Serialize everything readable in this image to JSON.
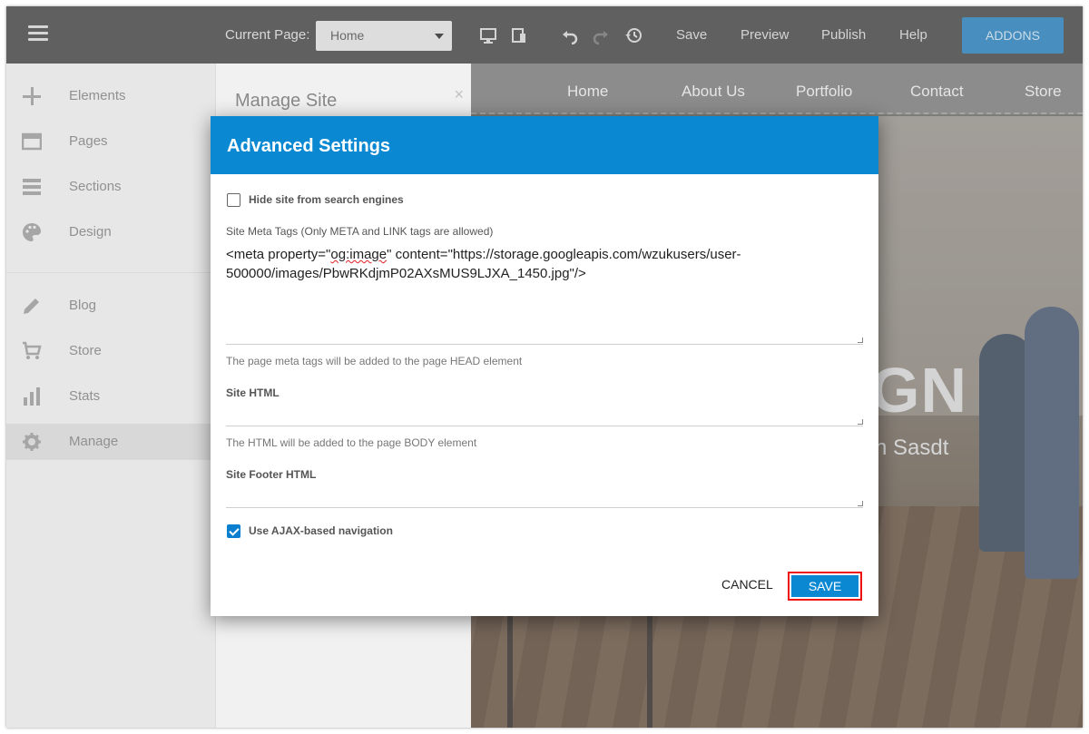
{
  "topbar": {
    "current_page_label": "Current Page:",
    "current_page_value": "Home",
    "save": "Save",
    "preview": "Preview",
    "publish": "Publish",
    "help": "Help",
    "addons": "ADDONS"
  },
  "sidebar": {
    "items": [
      {
        "label": "Elements",
        "icon": "plus-icon"
      },
      {
        "label": "Pages",
        "icon": "pages-icon"
      },
      {
        "label": "Sections",
        "icon": "sections-icon"
      },
      {
        "label": "Design",
        "icon": "palette-icon"
      },
      {
        "label": "Blog",
        "icon": "pencil-icon"
      },
      {
        "label": "Store",
        "icon": "cart-icon"
      },
      {
        "label": "Stats",
        "icon": "bar-chart-icon"
      },
      {
        "label": "Manage",
        "icon": "gear-icon",
        "active": true
      }
    ]
  },
  "manage_panel": {
    "title": "Manage Site",
    "close": "×"
  },
  "preview": {
    "nav": [
      "Home",
      "About Us",
      "Portfolio",
      "Contact",
      "Store"
    ],
    "hero_title_fragment": "GN",
    "hero_subtitle_fragment": "n Sasdt"
  },
  "modal": {
    "title": "Advanced Settings",
    "hide_search_label": "Hide site from search engines",
    "hide_search_checked": false,
    "meta_label": "Site Meta Tags (Only META and LINK tags are allowed)",
    "meta_value_pre": "<meta property=\"",
    "meta_value_mark": "og:image",
    "meta_value_post": "\" content=\"https://storage.googleapis.com/wzukusers/user-500000/images/PbwRKdjmP02AXsMUS9LJXA_1450.jpg\"/>",
    "meta_hint": "The page meta tags will be added to the page HEAD element",
    "site_html_label": "Site HTML",
    "site_html_value": "",
    "site_html_hint": "The HTML will be added to the page BODY element",
    "footer_html_label": "Site Footer HTML",
    "footer_html_value": "",
    "ajax_label": "Use AJAX-based navigation",
    "ajax_checked": true,
    "cancel": "CANCEL",
    "save": "SAVE"
  },
  "colors": {
    "accent": "#0a88d2",
    "highlight_border": "#e11111",
    "topbar": "#4a4a4a"
  }
}
